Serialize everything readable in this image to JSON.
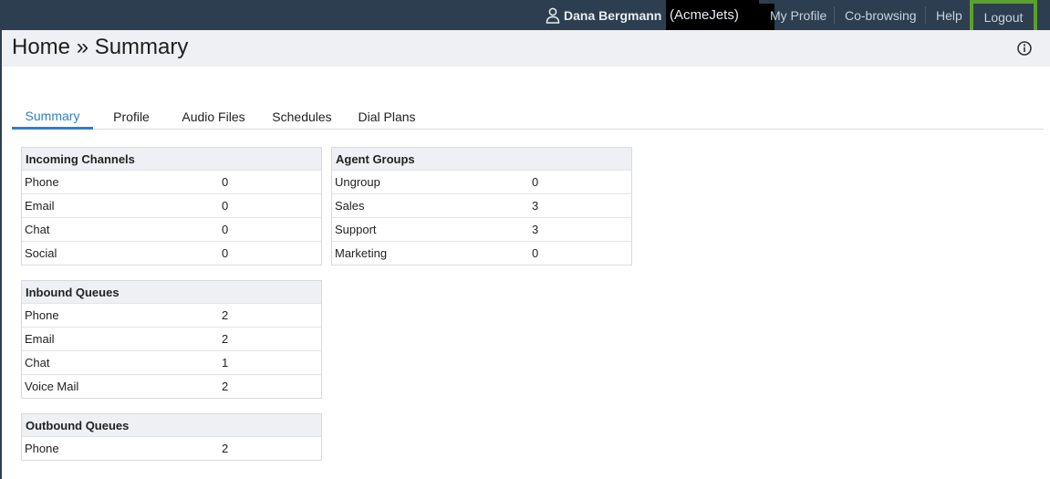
{
  "header": {
    "user_name": "Dana Bergmann",
    "org": "(AcmeJets)",
    "nav": {
      "my_profile": "My Profile",
      "cobrowsing": "Co-browsing",
      "help": "Help",
      "logout": "Logout"
    },
    "colors": {
      "bar": "#2c3e50",
      "logout_highlight": "#5aa02c"
    }
  },
  "page": {
    "title": "Home » Summary"
  },
  "tabs": [
    {
      "label": "Summary",
      "active": true
    },
    {
      "label": "Profile"
    },
    {
      "label": "Audio Files"
    },
    {
      "label": "Schedules"
    },
    {
      "label": "Dial Plans"
    }
  ],
  "panels": {
    "incoming_channels": {
      "title": "Incoming Channels",
      "rows": [
        {
          "label": "Phone",
          "value": "0"
        },
        {
          "label": "Email",
          "value": "0"
        },
        {
          "label": "Chat",
          "value": "0"
        },
        {
          "label": "Social",
          "value": "0"
        }
      ]
    },
    "agent_groups": {
      "title": "Agent Groups",
      "rows": [
        {
          "label": "Ungroup",
          "value": "0"
        },
        {
          "label": "Sales",
          "value": "3"
        },
        {
          "label": "Support",
          "value": "3"
        },
        {
          "label": "Marketing",
          "value": "0"
        }
      ]
    },
    "inbound_queues": {
      "title": "Inbound Queues",
      "rows": [
        {
          "label": "Phone",
          "value": "2"
        },
        {
          "label": "Email",
          "value": "2"
        },
        {
          "label": "Chat",
          "value": "1"
        },
        {
          "label": "Voice Mail",
          "value": "2"
        }
      ]
    },
    "outbound_queues": {
      "title": "Outbound Queues",
      "rows": [
        {
          "label": "Phone",
          "value": "2"
        }
      ]
    }
  },
  "icons": [
    "user-icon",
    "info-icon"
  ]
}
